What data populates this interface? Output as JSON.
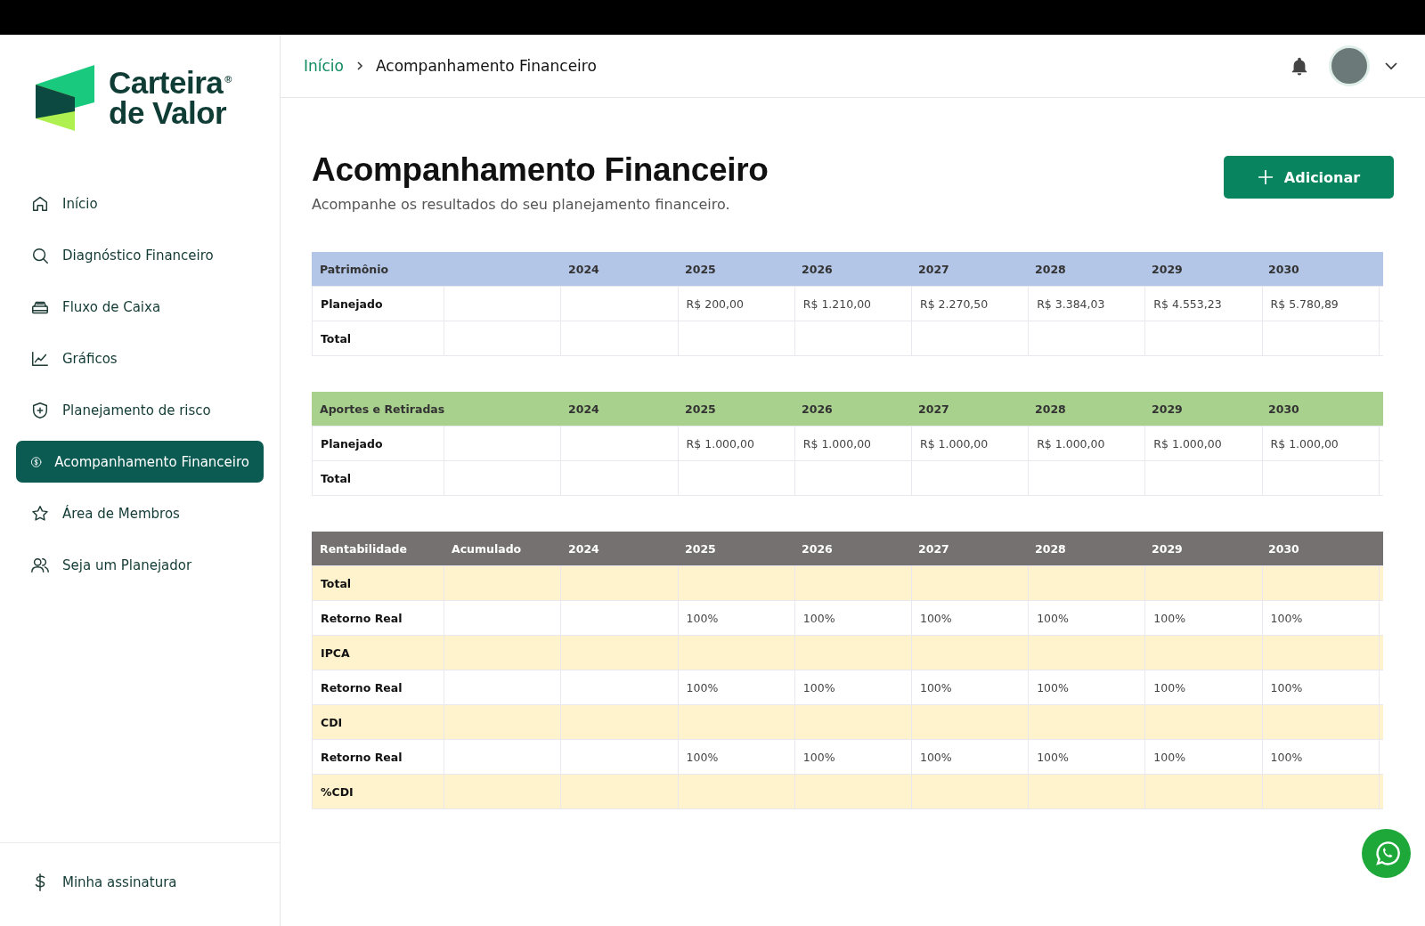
{
  "sidebar": {
    "logo": {
      "line1": "Carteira",
      "line2": "de Valor",
      "mark": "®"
    },
    "items": [
      {
        "label": "Início",
        "selected": false
      },
      {
        "label": "Diagnóstico Financeiro",
        "selected": false
      },
      {
        "label": "Fluxo de Caixa",
        "selected": false
      },
      {
        "label": "Gráficos",
        "selected": false
      },
      {
        "label": "Planejamento de risco",
        "selected": false
      },
      {
        "label": "Acompanhamento Financeiro",
        "selected": true
      },
      {
        "label": "Área de Membros",
        "selected": false
      },
      {
        "label": "Seja um Planejador",
        "selected": false
      }
    ],
    "footer_item": {
      "label": "Minha assinatura"
    }
  },
  "breadcrumb": [
    {
      "label": "Início",
      "link": true
    },
    {
      "label": "Acompanhamento Financeiro",
      "link": false
    }
  ],
  "page": {
    "title": "Acompanhamento Financeiro",
    "subtitle": "Acompanhe os resultados do seu planejamento financeiro.",
    "add_button": "Adicionar"
  },
  "tables": [
    {
      "color": "#b3c6e7",
      "columns": [
        "Patrimônio",
        "",
        "2024",
        "2025",
        "2026",
        "2027",
        "2028",
        "2029",
        "2030"
      ],
      "rows": [
        {
          "highlighted": false,
          "cells": [
            "Planejado",
            "",
            "",
            "R$ 200,00",
            "R$ 1.210,00",
            "R$ 2.270,50",
            "R$ 3.384,03",
            "R$ 4.553,23",
            "R$ 5.780,89"
          ]
        },
        {
          "highlighted": false,
          "cells": [
            "Total",
            "",
            "",
            "",
            "",
            "",
            "",
            "",
            ""
          ]
        }
      ]
    },
    {
      "color": "#a9d18e",
      "columns": [
        "Aportes e Retiradas",
        "",
        "2024",
        "2025",
        "2026",
        "2027",
        "2028",
        "2029",
        "2030"
      ],
      "rows": [
        {
          "highlighted": false,
          "cells": [
            "Planejado",
            "",
            "",
            "R$ 1.000,00",
            "R$ 1.000,00",
            "R$ 1.000,00",
            "R$ 1.000,00",
            "R$ 1.000,00",
            "R$ 1.000,00"
          ]
        },
        {
          "highlighted": false,
          "cells": [
            "Total",
            "",
            "",
            "",
            "",
            "",
            "",
            "",
            ""
          ]
        }
      ]
    },
    {
      "color": "#767171",
      "columns": [
        "Rentabilidade",
        "Acumulado",
        "2024",
        "2025",
        "2026",
        "2027",
        "2028",
        "2029",
        "2030"
      ],
      "rows": [
        {
          "highlighted": true,
          "cells": [
            "Total",
            "",
            "",
            "",
            "",
            "",
            "",
            "",
            ""
          ]
        },
        {
          "highlighted": false,
          "cells": [
            "Retorno Real",
            "",
            "",
            "100%",
            "100%",
            "100%",
            "100%",
            "100%",
            "100%"
          ]
        },
        {
          "highlighted": true,
          "cells": [
            "IPCA",
            "",
            "",
            "",
            "",
            "",
            "",
            "",
            ""
          ]
        },
        {
          "highlighted": false,
          "cells": [
            "Retorno Real",
            "",
            "",
            "100%",
            "100%",
            "100%",
            "100%",
            "100%",
            "100%"
          ]
        },
        {
          "highlighted": true,
          "cells": [
            "CDI",
            "",
            "",
            "",
            "",
            "",
            "",
            "",
            ""
          ]
        },
        {
          "highlighted": false,
          "cells": [
            "Retorno Real",
            "",
            "",
            "100%",
            "100%",
            "100%",
            "100%",
            "100%",
            "100%"
          ]
        },
        {
          "highlighted": true,
          "cells": [
            "%CDI",
            "",
            "",
            "",
            "",
            "",
            "",
            "",
            ""
          ]
        }
      ]
    }
  ]
}
